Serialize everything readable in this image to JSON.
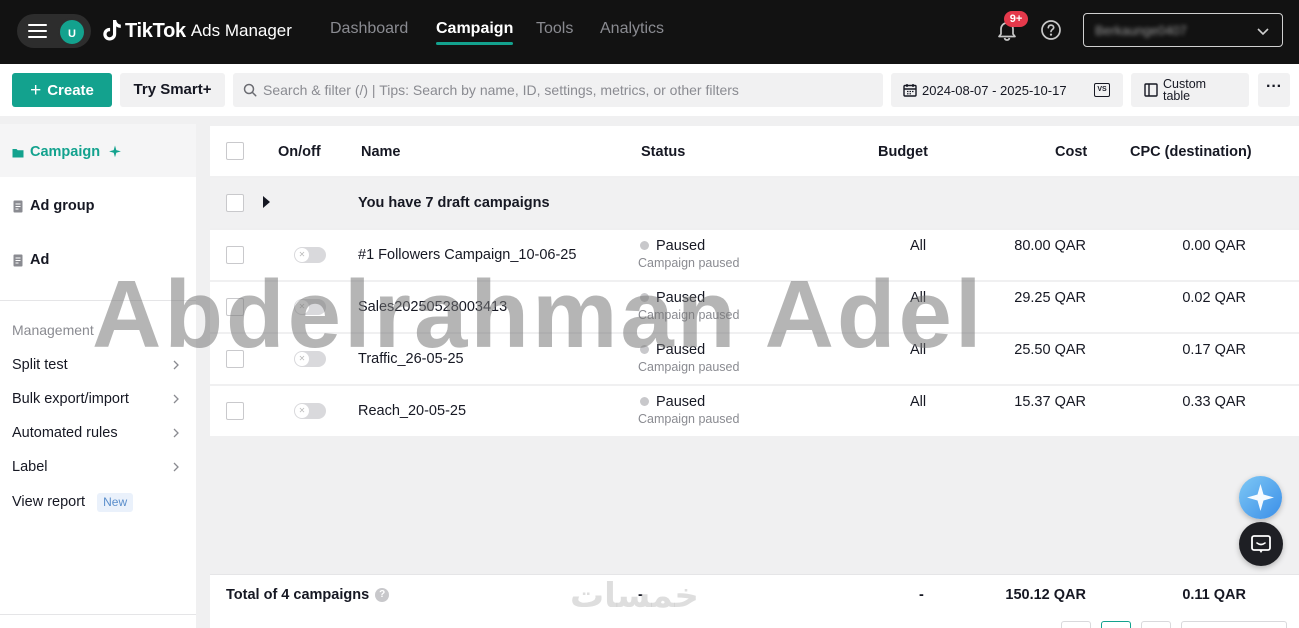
{
  "topbar": {
    "avatar_initial": "U",
    "brand": "TikTok",
    "product": "Ads Manager",
    "nav": [
      "Dashboard",
      "Campaign",
      "Tools",
      "Analytics"
    ],
    "active_nav": "Campaign",
    "notification_badge": "9+",
    "account_name": "Berkaunge0407"
  },
  "toolbar": {
    "create_label": "Create",
    "create_plus": "+",
    "smart_label": "Try Smart+",
    "search_placeholder": "Search & filter (/) | Tips: Search by name, ID, settings, metrics, or other filters",
    "date_range": "2024-08-07 - 2025-10-17",
    "vs_label": "VS",
    "custom_table_label": "Custom table",
    "more_label": "···"
  },
  "sidebar": {
    "levels": [
      "Campaign",
      "Ad group",
      "Ad"
    ],
    "management_heading": "Management",
    "links": [
      "Split test",
      "Bulk export/import",
      "Automated rules",
      "Label",
      "View report"
    ],
    "new_badge": "New"
  },
  "table": {
    "columns": [
      "On/off",
      "Name",
      "Status",
      "Budget",
      "Cost",
      "CPC (destination)"
    ],
    "draft_text": "You have 7 draft campaigns",
    "rows": [
      {
        "name": "#1 Followers Campaign_10-06-25",
        "status": "Paused",
        "status_sub": "Campaign paused",
        "budget": "All",
        "cost": "80.00 QAR",
        "cpc": "0.00 QAR"
      },
      {
        "name": "Sales20250528003413",
        "status": "Paused",
        "status_sub": "Campaign paused",
        "budget": "All",
        "cost": "29.25 QAR",
        "cpc": "0.02 QAR"
      },
      {
        "name": "Traffic_26-05-25",
        "status": "Paused",
        "status_sub": "Campaign paused",
        "budget": "All",
        "cost": "25.50 QAR",
        "cpc": "0.17 QAR"
      },
      {
        "name": "Reach_20-05-25",
        "status": "Paused",
        "status_sub": "Campaign paused",
        "budget": "All",
        "cost": "15.37 QAR",
        "cpc": "0.33 QAR"
      }
    ],
    "total_label": "Total of 4 campaigns",
    "total_status": "-",
    "total_budget": "-",
    "total_cost": "150.12 QAR",
    "total_cpc": "0.11 QAR"
  },
  "watermark": {
    "main": "Abdelrahman Adel",
    "secondary": "خمسات"
  },
  "colors": {
    "accent": "#13a28e",
    "topbar_bg": "#121212",
    "badge": "#e5394b"
  }
}
